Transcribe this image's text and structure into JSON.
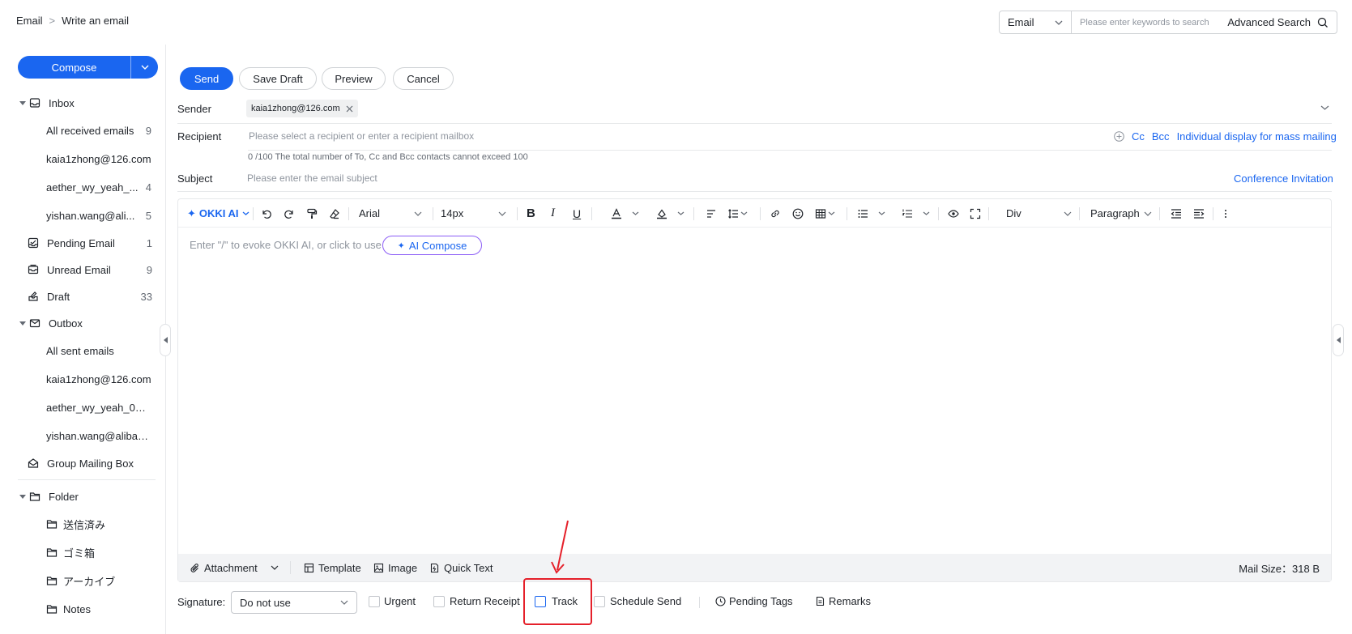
{
  "breadcrumb": {
    "root": "Email",
    "separator": ">",
    "current": "Write an email"
  },
  "search": {
    "type": "Email",
    "placeholder": "Please enter keywords to search",
    "advanced_label": "Advanced Search"
  },
  "sidebar": {
    "compose_label": "Compose",
    "inbox": {
      "label": "Inbox",
      "items": [
        {
          "label": "All received emails",
          "count": "9"
        },
        {
          "label": "kaia1zhong@126.com",
          "count": ""
        },
        {
          "label": "aether_wy_yeah_...",
          "count": "4"
        },
        {
          "label": "yishan.wang@ali...",
          "count": "5"
        }
      ]
    },
    "pending": {
      "label": "Pending Email",
      "count": "1"
    },
    "unread": {
      "label": "Unread Email",
      "count": "9"
    },
    "draft": {
      "label": "Draft",
      "count": "33"
    },
    "outbox": {
      "label": "Outbox",
      "items": [
        {
          "label": "All sent emails"
        },
        {
          "label": "kaia1zhong@126.com"
        },
        {
          "label": "aether_wy_yeah_01@..."
        },
        {
          "label": "yishan.wang@alibaba-..."
        }
      ]
    },
    "group_mailing": {
      "label": "Group Mailing Box"
    },
    "folder": {
      "label": "Folder",
      "items": [
        {
          "label": "送信済み"
        },
        {
          "label": "ゴミ箱"
        },
        {
          "label": "アーカイブ"
        },
        {
          "label": "Notes"
        }
      ]
    }
  },
  "actions": {
    "send": "Send",
    "save_draft": "Save Draft",
    "preview": "Preview",
    "cancel": "Cancel"
  },
  "form": {
    "sender_label": "Sender",
    "sender_value": "kaia1zhong@126.com",
    "recipient_label": "Recipient",
    "recipient_placeholder": "Please select a recipient or enter a recipient mailbox",
    "cc": "Cc",
    "bcc": "Bcc",
    "individual_display": "Individual display for mass mailing",
    "recipient_hint": "0 /100 The total number of To, Cc and Bcc contacts cannot exceed 100",
    "subject_label": "Subject",
    "subject_placeholder": "Please enter the email subject",
    "conference_invitation": "Conference Invitation"
  },
  "editor": {
    "okki_label": "OKKI AI",
    "font_family": "Arial",
    "font_size": "14px",
    "block_type": "Div",
    "paragraph": "Paragraph",
    "placeholder": "Enter \"/\" to evoke OKKI AI, or click to use",
    "ai_compose": "AI Compose",
    "footer": {
      "attachment": "Attachment",
      "template": "Template",
      "image": "Image",
      "quick_text": "Quick Text",
      "mail_size": "Mail Size：318 B"
    }
  },
  "options": {
    "signature_label": "Signature:",
    "signature_value": "Do not use",
    "urgent": "Urgent",
    "return_receipt": "Return Receipt",
    "track": "Track",
    "schedule_send": "Schedule Send",
    "pending_tags": "Pending Tags",
    "remarks": "Remarks"
  },
  "colors": {
    "accent": "#1a66f0",
    "highlight": "#e5202a",
    "ai_border": "#8b5cf6"
  }
}
